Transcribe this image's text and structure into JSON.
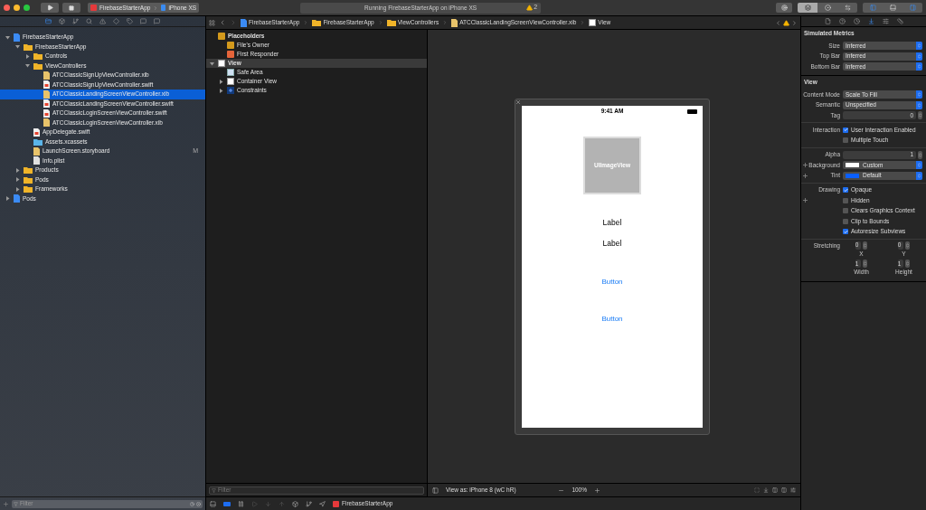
{
  "toolbar": {
    "scheme": "FirebaseStarterApp",
    "device": "iPhone XS",
    "activity": "Running FirebaseStarterApp on iPhone XS",
    "warning_count": "2"
  },
  "navigator": {
    "tabs": [
      {
        "selected": true
      },
      {
        "selected": false
      },
      {
        "selected": false
      },
      {
        "selected": false
      },
      {
        "selected": false
      },
      {
        "selected": false
      },
      {
        "selected": false
      },
      {
        "selected": false
      },
      {
        "selected": false
      }
    ],
    "tree": [
      {
        "kind": "project",
        "label": "FirebaseStarterApp",
        "expanded": true,
        "selected": false,
        "children": [
          {
            "kind": "folder",
            "label": "FirebaseStarterApp",
            "expanded": true,
            "selected": false,
            "children": [
              {
                "kind": "folder",
                "label": "Controls",
                "expanded": false,
                "selected": false
              },
              {
                "kind": "folder",
                "label": "ViewControllers",
                "expanded": true,
                "selected": false,
                "children": [
                  {
                    "kind": "xib",
                    "label": "ATCClassicSignUpViewController.xib",
                    "selected": false
                  },
                  {
                    "kind": "swift",
                    "label": "ATCClassicSignUpViewController.swift",
                    "selected": false
                  },
                  {
                    "kind": "xib",
                    "label": "ATCClassicLandingScreenViewController.xib",
                    "selected": true
                  },
                  {
                    "kind": "swift",
                    "label": "ATCClassicLandingScreenViewController.swift",
                    "selected": false
                  },
                  {
                    "kind": "swift",
                    "label": "ATCClassicLoginScreenViewController.swift",
                    "selected": false
                  },
                  {
                    "kind": "xib",
                    "label": "ATCClassicLoginScreenViewController.xib",
                    "selected": false
                  }
                ]
              },
              {
                "kind": "swift",
                "label": "AppDelegate.swift",
                "selected": false
              },
              {
                "kind": "assets",
                "label": "Assets.xcassets",
                "selected": false
              },
              {
                "kind": "xib",
                "label": "LaunchScreen.storyboard",
                "selected": false,
                "badge": "M"
              },
              {
                "kind": "plist",
                "label": "Info.plist",
                "selected": false
              }
            ]
          },
          {
            "kind": "folder",
            "label": "Products",
            "expanded": false,
            "selected": false
          },
          {
            "kind": "folder",
            "label": "Pods",
            "expanded": false,
            "selected": false
          },
          {
            "kind": "folder",
            "label": "Frameworks",
            "expanded": false,
            "selected": false
          }
        ]
      },
      {
        "kind": "project",
        "label": "Pods",
        "expanded": false,
        "selected": false
      }
    ],
    "filter": {
      "placeholder": "Filter"
    }
  },
  "jump_bar": {
    "crumbs": [
      {
        "kind": "project",
        "label": "FirebaseStarterApp"
      },
      {
        "kind": "folder",
        "label": "FirebaseStarterApp"
      },
      {
        "kind": "folder",
        "label": "ViewControllers"
      },
      {
        "kind": "xib",
        "label": "ATCClassicLandingScreenViewController.xib"
      },
      {
        "kind": "view",
        "label": "View"
      }
    ]
  },
  "outline": {
    "items": [
      {
        "kind": "cube",
        "label": "Placeholders",
        "selected": false,
        "children": [
          {
            "kind": "cube",
            "label": "File's Owner",
            "selected": false
          },
          {
            "kind": "responder",
            "label": "First Responder",
            "selected": false
          }
        ]
      },
      {
        "kind": "view",
        "label": "View",
        "expanded": true,
        "selected": true,
        "children": [
          {
            "kind": "safearea",
            "label": "Safe Area",
            "selected": false
          },
          {
            "kind": "view",
            "label": "Container View",
            "expanded": false,
            "selected": false
          },
          {
            "kind": "constraints",
            "label": "Constraints",
            "expanded": false,
            "selected": false
          }
        ]
      }
    ],
    "filter": {
      "placeholder": "Filter"
    }
  },
  "canvas": {
    "status_time": "9:41 AM",
    "image_view": "UIImageView",
    "elements": [
      {
        "kind": "label",
        "text": "Label"
      },
      {
        "kind": "label",
        "text": "Label"
      },
      {
        "kind": "button",
        "text": "Button"
      },
      {
        "kind": "button",
        "text": "Button"
      }
    ],
    "view_as": "View as: iPhone 8 (wC hR)",
    "zoom": "100%"
  },
  "debug_bar": {
    "app": "FirebaseStarterApp"
  },
  "inspector": {
    "tabs": [
      {
        "selected": false
      },
      {
        "selected": false
      },
      {
        "selected": false
      },
      {
        "selected": true
      },
      {
        "selected": false
      },
      {
        "selected": false
      }
    ],
    "sections": [
      {
        "title": "Simulated Metrics",
        "groups": [
          [
            {
              "kind": "select",
              "label": "Size",
              "value": "Inferred"
            },
            {
              "kind": "select",
              "label": "Top Bar",
              "value": "Inferred"
            },
            {
              "kind": "select",
              "label": "Bottom Bar",
              "value": "Inferred"
            }
          ]
        ]
      },
      {
        "title": "View",
        "groups": [
          [
            {
              "kind": "select",
              "label": "Content Mode",
              "value": "Scale To Fill"
            },
            {
              "kind": "select",
              "label": "Semantic",
              "value": "Unspecified"
            },
            {
              "kind": "stepper",
              "label": "Tag",
              "value": "0"
            }
          ],
          [
            {
              "kind": "checkbox",
              "label": "Interaction",
              "text": "User Interaction Enabled",
              "checked": true
            },
            {
              "kind": "checkbox",
              "text": "Multiple Touch",
              "checked": false
            }
          ],
          [
            {
              "kind": "stepper",
              "label": "Alpha",
              "value": "1"
            },
            {
              "kind": "color",
              "label": "Background",
              "value": "Custom",
              "color": "#ffffff",
              "plus": true
            },
            {
              "kind": "color",
              "label": "Tint",
              "value": "Default",
              "color": "#0a5fff",
              "plus": true
            }
          ],
          [
            {
              "kind": "checkbox",
              "label": "Drawing",
              "text": "Opaque",
              "checked": true
            },
            {
              "kind": "checkbox",
              "text": "Hidden",
              "checked": false,
              "plus": true
            },
            {
              "kind": "checkbox",
              "text": "Clears Graphics Context",
              "checked": false
            },
            {
              "kind": "checkbox",
              "text": "Clip to Bounds",
              "checked": false
            },
            {
              "kind": "checkbox",
              "text": "Autoresize Subviews",
              "checked": true
            }
          ],
          [
            {
              "kind": "pair",
              "label": "Stretching",
              "fields": [
                {
                  "value": "0",
                  "caption": "X"
                },
                {
                  "value": "0",
                  "caption": "Y"
                }
              ]
            },
            {
              "kind": "pair",
              "fields": [
                {
                  "value": "1",
                  "caption": "Width"
                },
                {
                  "value": "1",
                  "caption": "Height"
                }
              ]
            }
          ]
        ]
      }
    ]
  }
}
